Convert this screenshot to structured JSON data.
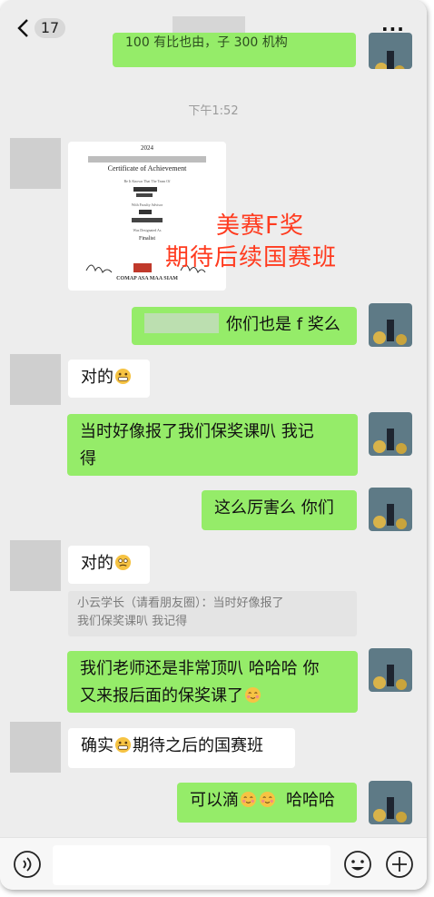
{
  "header": {
    "back_count": "17",
    "more_label": "···"
  },
  "chat": {
    "top_partial_text": "100 有比也由，子 300 机构",
    "timestamp": "下午1:52",
    "certificate": {
      "year": "2024",
      "title": "Certificate of Achievement",
      "line1": "Be It Known That The Team Of",
      "line2": "With Faculty Advisor",
      "line3": "Was Designated As",
      "designation": "Finalist",
      "sponsors": "COMAP  ASA  MAA  SIAM"
    },
    "overlay": {
      "line1": "美赛F奖",
      "line2": "期待后续国赛班"
    },
    "messages": [
      {
        "id": "m1",
        "text": "你们也是 f 奖么"
      },
      {
        "id": "m2",
        "text": "对的"
      },
      {
        "id": "m3_line1",
        "text": "当时好像报了我们保奖课叭 我记"
      },
      {
        "id": "m3_line2",
        "text": "得"
      },
      {
        "id": "m4",
        "text": "这么厉害么 你们"
      },
      {
        "id": "m5",
        "text": "对的"
      },
      {
        "id": "m6_line1",
        "text": "我们老师还是非常顶叭 哈哈哈 你"
      },
      {
        "id": "m6_line2",
        "text": "又来报后面的保奖课了"
      },
      {
        "id": "m7_a",
        "text": "确实"
      },
      {
        "id": "m7_b",
        "text": "期待之后的国赛班"
      },
      {
        "id": "m8_a",
        "text": "可以滴"
      },
      {
        "id": "m8_b",
        "text": "哈哈哈"
      }
    ],
    "quote": {
      "line1": "小云学长（请看朋友圈）：当时好像报了",
      "line2": "我们保奖课叭 我记得"
    }
  },
  "icons": [
    "chevron-left-icon",
    "more-dots-icon",
    "voice-icon",
    "emoji-icon",
    "plus-icon",
    "grin-emoji",
    "smirk-emoji",
    "blush-emoji"
  ]
}
